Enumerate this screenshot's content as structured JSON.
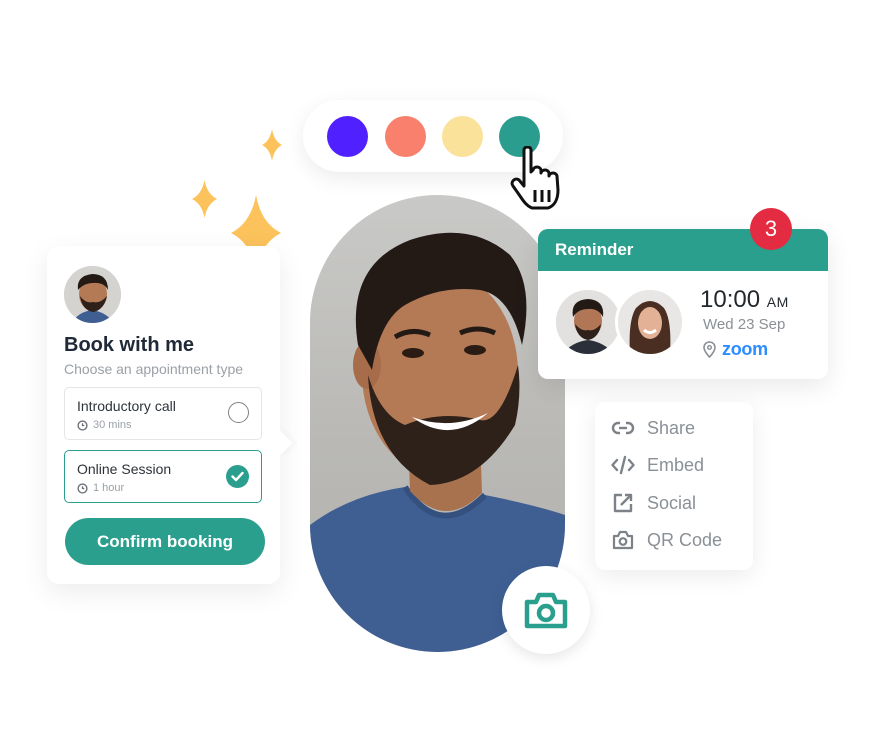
{
  "palette": {
    "swatches": [
      {
        "name": "purple",
        "color": "#5120ff"
      },
      {
        "name": "coral",
        "color": "#f9806c"
      },
      {
        "name": "yellow",
        "color": "#fbe29a"
      },
      {
        "name": "teal",
        "color": "#2a9d8f",
        "selected": true
      }
    ]
  },
  "booking": {
    "title": "Book with me",
    "subtitle": "Choose an appointment type",
    "options": [
      {
        "name": "Introductory call",
        "duration": "30 mins",
        "selected": false
      },
      {
        "name": "Online Session",
        "duration": "1 hour",
        "selected": true
      }
    ],
    "confirm_label": "Confirm booking"
  },
  "reminder": {
    "title": "Reminder",
    "badge_count": "3",
    "time": "10:00",
    "ampm": "AM",
    "date": "Wed 23 Sep",
    "location": "zoom"
  },
  "share_menu": {
    "items": [
      {
        "label": "Share",
        "icon": "link-icon"
      },
      {
        "label": "Embed",
        "icon": "code-icon"
      },
      {
        "label": "Social",
        "icon": "external-link-icon"
      },
      {
        "label": "QR Code",
        "icon": "camera-icon"
      }
    ]
  },
  "colors": {
    "accent": "#2b9f8e",
    "badge": "#e32b41",
    "sparkle": "#fcc25b",
    "zoom_blue": "#2d8cff"
  }
}
